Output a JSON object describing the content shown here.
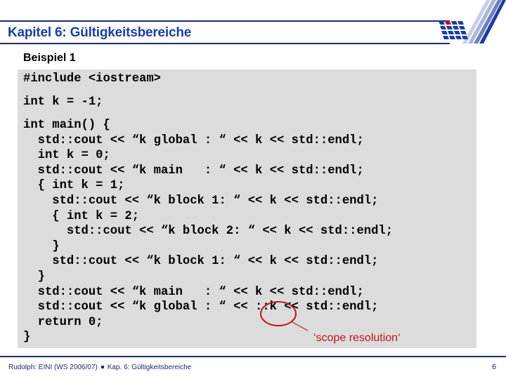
{
  "header": {
    "title": "Kapitel 6: Gültigkeitsbereiche"
  },
  "slide": {
    "subtitle": "Beispiel 1",
    "code_lines": [
      "#include <iostream>",
      "int k = -1;",
      "int main() {",
      "  std::cout << “k global : “ << k << std::endl;",
      "  int k = 0;",
      "  std::cout << “k main   : “ << k << std::endl;",
      "  { int k = 1;",
      "    std::cout << “k block 1: “ << k << std::endl;",
      "    { int k = 2;",
      "      std::cout << “k block 2: “ << k << std::endl;",
      "    }",
      "    std::cout << “k block 1: “ << k << std::endl;",
      "  }",
      "  std::cout << “k main   : “ << k << std::endl;",
      "  std::cout << “k global : “ << ::k << std::endl;",
      "  return 0;",
      "}"
    ],
    "annotation": "‘scope resolution‘",
    "annotation_color": "#c0141c"
  },
  "footer": {
    "left_a": "Rudolph: EINI (WS 2006/07)",
    "left_b": "Kap. 6: Gültigkeitsbereiche",
    "page_number": "6"
  },
  "colors": {
    "brand_blue": "#1b3ea0",
    "rule_navy": "#1c2c6e",
    "code_bg": "#dcdcdc"
  }
}
